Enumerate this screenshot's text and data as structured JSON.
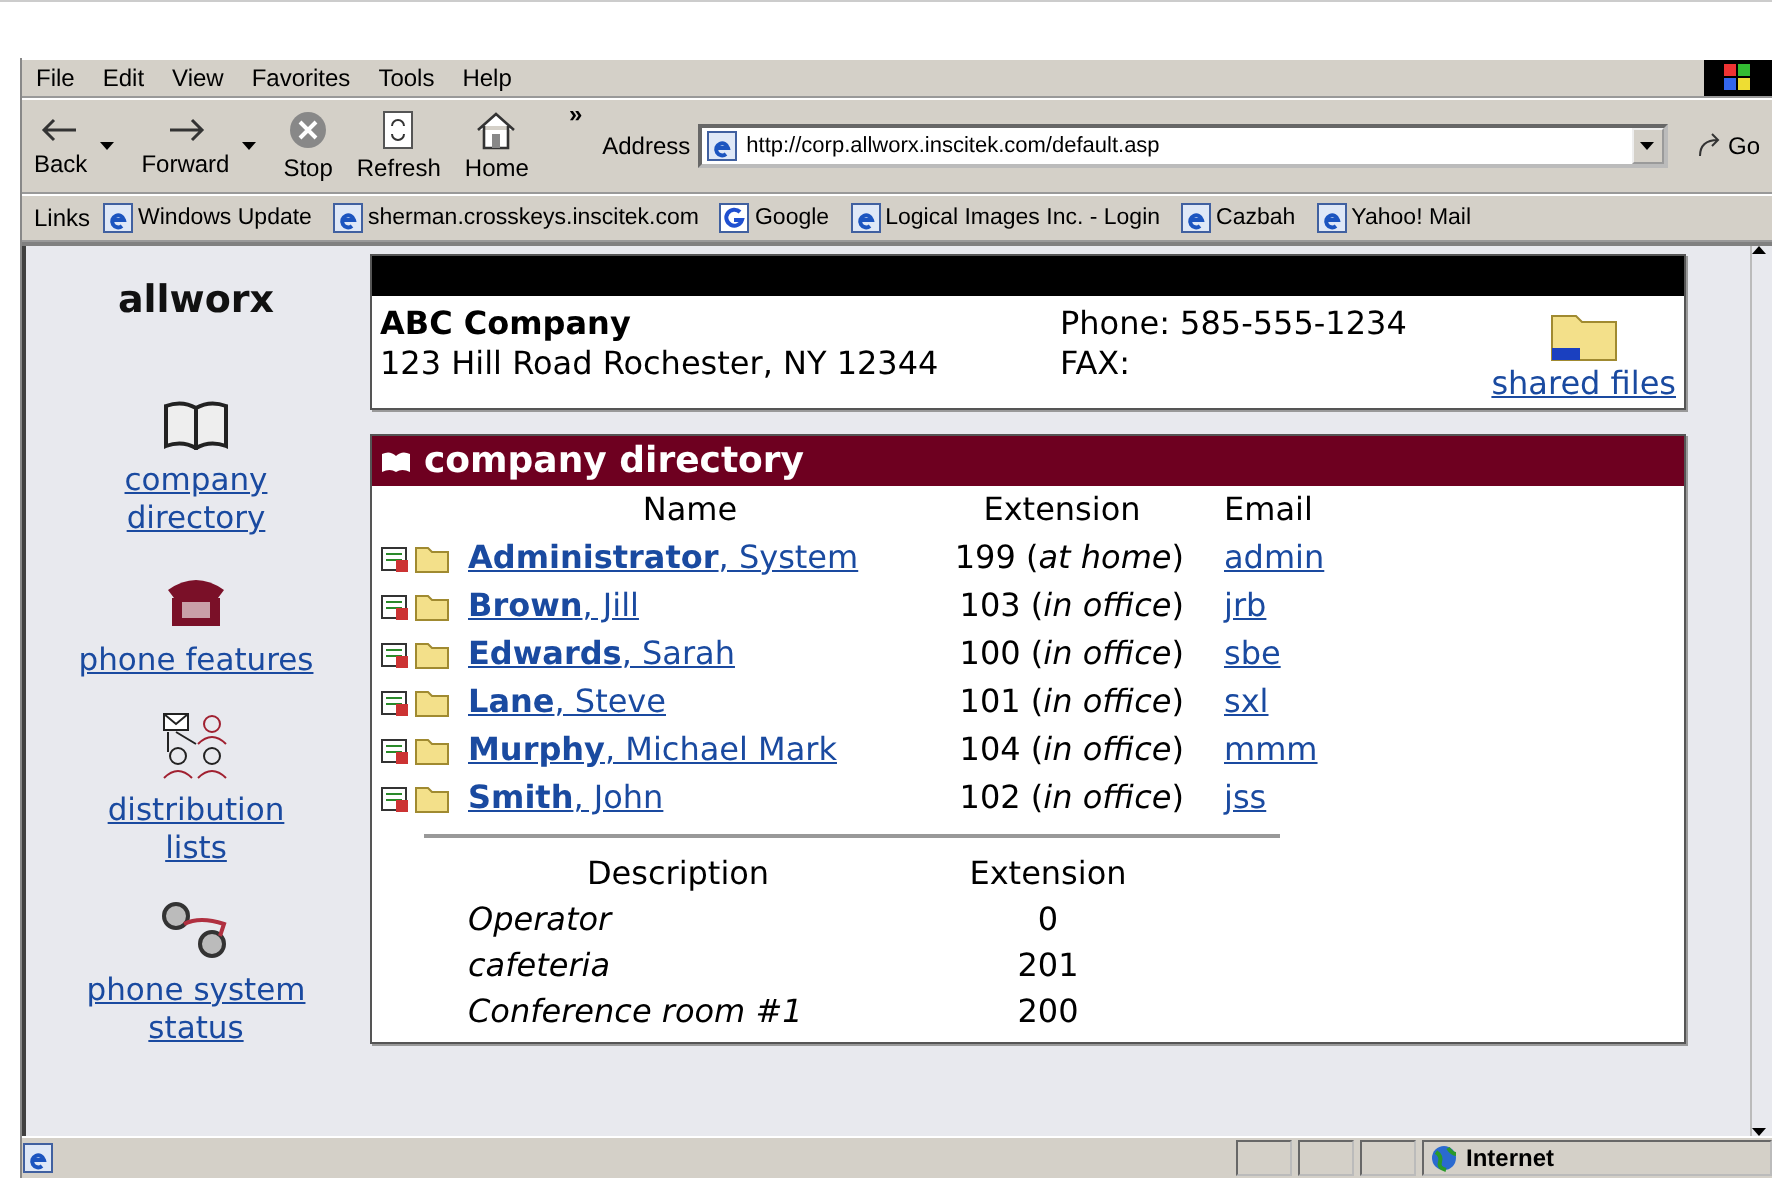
{
  "menu": [
    "File",
    "Edit",
    "View",
    "Favorites",
    "Tools",
    "Help"
  ],
  "toolbar": [
    {
      "label": "Back",
      "kind": "back",
      "dropdown": true
    },
    {
      "label": "Forward",
      "kind": "forward",
      "dropdown": true
    },
    {
      "label": "Stop",
      "kind": "stop",
      "dropdown": false
    },
    {
      "label": "Refresh",
      "kind": "refresh",
      "dropdown": false
    },
    {
      "label": "Home",
      "kind": "home",
      "dropdown": false
    }
  ],
  "chevron": "»",
  "address": {
    "label": "Address",
    "value": "http://corp.allworx.inscitek.com/default.asp",
    "go": "Go"
  },
  "links": {
    "label": "Links",
    "items": [
      {
        "label": "Windows Update",
        "kind": "ie"
      },
      {
        "label": "sherman.crosskeys.inscitek.com",
        "kind": "ie"
      },
      {
        "label": "Google",
        "kind": "google"
      },
      {
        "label": "Logical Images Inc. - Login",
        "kind": "ie"
      },
      {
        "label": "Cazbah",
        "kind": "ie"
      },
      {
        "label": "Yahoo! Mail",
        "kind": "ie"
      }
    ]
  },
  "logo": {
    "text": "allworx"
  },
  "sidebar": {
    "items": [
      {
        "label": "company directory",
        "kind": "book"
      },
      {
        "label": "phone features",
        "kind": "phone"
      },
      {
        "label": "distribution lists",
        "kind": "people"
      },
      {
        "label": "phone system status",
        "kind": "status"
      }
    ]
  },
  "company": {
    "name": "ABC Company",
    "address": "123 Hill Road Rochester, NY 12344",
    "phone": "Phone: 585-555-1234",
    "fax": "FAX:",
    "shared": "shared files"
  },
  "directory": {
    "title": "company directory",
    "columns": [
      "Name",
      "Extension",
      "Email"
    ],
    "rows": [
      {
        "name": "**Administrator**, System",
        "extension": "199 (*at home*)",
        "email": "admin"
      },
      {
        "name": "**Brown**, Jill",
        "extension": "103 (*in office*)",
        "email": "jrb"
      },
      {
        "name": "**Edwards**, Sarah",
        "extension": "100 (*in office*)",
        "email": "sbe"
      },
      {
        "name": "**Lane**, Steve",
        "extension": "101 (*in office*)",
        "email": "sxl"
      },
      {
        "name": "**Murphy**, Michael Mark",
        "extension": "104 (*in office*)",
        "email": "mmm"
      },
      {
        "name": "**Smith**, John",
        "extension": "102 (*in office*)",
        "email": "jss"
      }
    ],
    "other_columns": [
      "Description",
      "Extension"
    ],
    "other_rows": [
      {
        "description": "Operator",
        "extension": "0"
      },
      {
        "description": "cafeteria",
        "extension": "201"
      },
      {
        "description": "Conference room #1",
        "extension": "200"
      }
    ]
  },
  "status_bar": {
    "zone": "Internet"
  }
}
